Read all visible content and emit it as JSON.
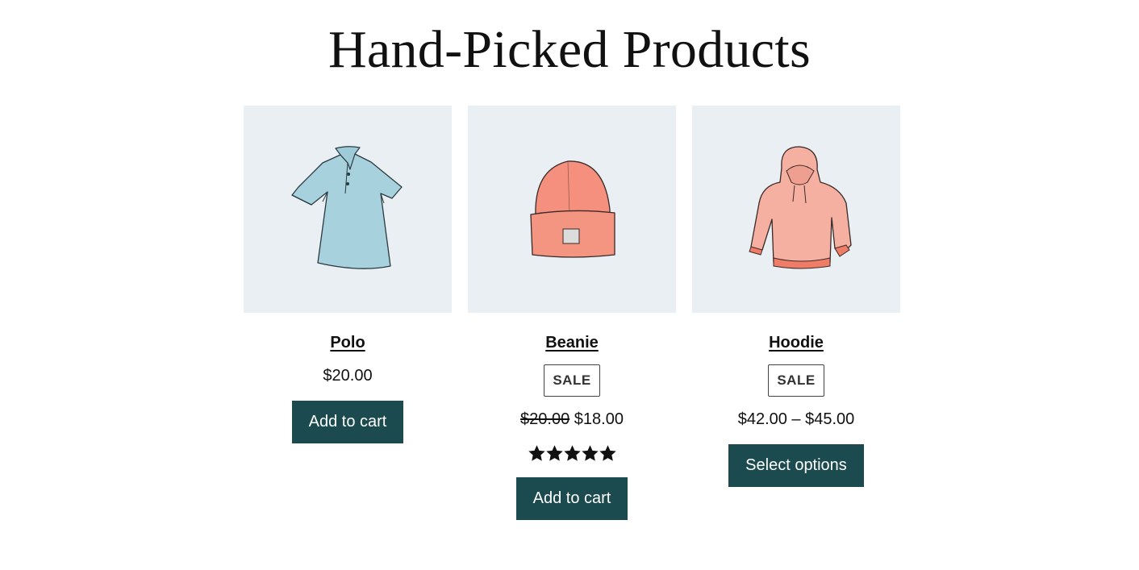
{
  "title": "Hand-Picked Products",
  "colors": {
    "thumb_bg": "#e9eff3",
    "button_bg": "#1b4a4f",
    "button_text": "#ffffff"
  },
  "products": [
    {
      "name": "Polo",
      "image": "polo-shirt-illustration",
      "price": "$20.00",
      "button": "Add to cart"
    },
    {
      "name": "Beanie",
      "image": "beanie-illustration",
      "badge": "SALE",
      "old_price": "$20.00",
      "price": "$18.00",
      "rating": 5,
      "button": "Add to cart"
    },
    {
      "name": "Hoodie",
      "image": "hoodie-illustration",
      "badge": "SALE",
      "price": "$42.00 – $45.00",
      "button": "Select options"
    }
  ]
}
